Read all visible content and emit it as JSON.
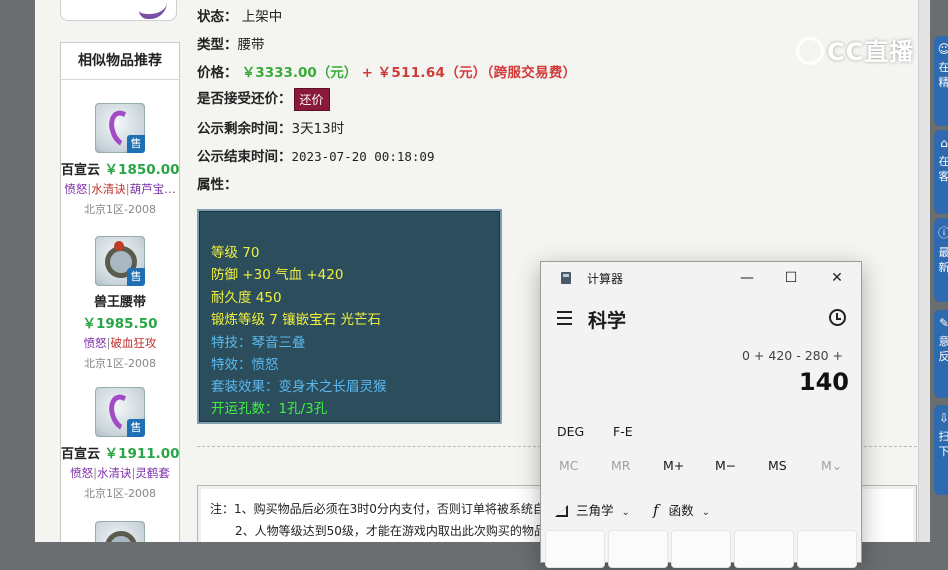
{
  "similar": {
    "title": "相似物品推荐",
    "sale_badge": "售",
    "items": [
      {
        "name": "百宣云",
        "price": "￥1850.00",
        "skills": [
          {
            "text": "愤怒",
            "kind": "purple"
          },
          {
            "text": "水清诀",
            "kind": "red"
          },
          {
            "text": "葫芦宝…",
            "kind": "purple"
          }
        ],
        "server": "北京1区-2008"
      },
      {
        "name": "兽王腰带",
        "price": "￥1985.50",
        "skills": [
          {
            "text": "愤怒",
            "kind": "purple"
          },
          {
            "text": "破血狂攻",
            "kind": "red"
          }
        ],
        "server": "北京1区-2008"
      },
      {
        "name": "百宣云",
        "price": "￥1911.00",
        "skills": [
          {
            "text": "愤怒",
            "kind": "purple"
          },
          {
            "text": "水清诀",
            "kind": "purple"
          },
          {
            "text": "灵鹤套",
            "kind": "purple"
          }
        ],
        "server": "北京1区-2008"
      }
    ],
    "separator": "|"
  },
  "detail": {
    "status_label": "状态：",
    "status_value": "上架中",
    "type_label": "类型：",
    "type_value": "腰带",
    "price_label": "价格：",
    "price_main": "￥3333.00（元）",
    "price_plus": "+",
    "price_fee": "￥511.64（元）（跨服交易费）",
    "haggle_label": "是否接受还价：",
    "haggle_button": "还价",
    "remain_label": "公示剩余时间：",
    "remain_value": "3天13时",
    "end_label": "公示结束时间：",
    "end_value": "2023-07-20 00:18:09",
    "attr_label": "属性："
  },
  "attributes": [
    {
      "text": "等级 70",
      "color": "yellow"
    },
    {
      "text": "防御 +30 气血 +420",
      "color": "yellow"
    },
    {
      "text": "耐久度 450",
      "color": "yellow"
    },
    {
      "text": "锻炼等级 7 镶嵌宝石 光芒石",
      "color": "yellow"
    },
    {
      "text": "特技：琴音三叠",
      "color": "blue"
    },
    {
      "text": "特效：愤怒",
      "color": "blue"
    },
    {
      "text": "套装效果：变身术之长眉灵猴",
      "color": "blue"
    },
    {
      "text": "开运孔数：1孔/3孔",
      "color": "green"
    }
  ],
  "notice": {
    "line1": "注：1、购买物品后必须在3时0分内支付，否则订单将被系统自",
    "line2": "2、人物等级达到50级，才能在游戏内取出此次购买的物品"
  },
  "overlay": {
    "logo_text": "CC直播"
  },
  "rail": {
    "tabs": [
      {
        "icon": "☺",
        "text": "在\n精"
      },
      {
        "icon": "⌂",
        "text": "在\n客"
      },
      {
        "icon": "ⓘ",
        "text": "最\n新"
      },
      {
        "icon": "✎",
        "text": "意\n反"
      },
      {
        "icon": "⇩",
        "text": "扫\n下"
      }
    ]
  },
  "calculator": {
    "title": "计算器",
    "win_min": "—",
    "win_max": "☐",
    "win_close": "✕",
    "mode": "科学",
    "expression": "0 + 420 - 280 +",
    "display": "140",
    "deg": "DEG",
    "fe": "F-E",
    "mem": [
      "MC",
      "MR",
      "M+",
      "M−",
      "MS",
      "M⌄"
    ],
    "trig": "三角学",
    "func": "函数",
    "chev": "⌄"
  },
  "colors": {
    "accent_blue": "#2d6ab0",
    "price_red": "#d03a3a",
    "price_green": "#28a545",
    "attr_bg": "#2c4e5c",
    "haggle_btn": "#8a1a3a"
  }
}
